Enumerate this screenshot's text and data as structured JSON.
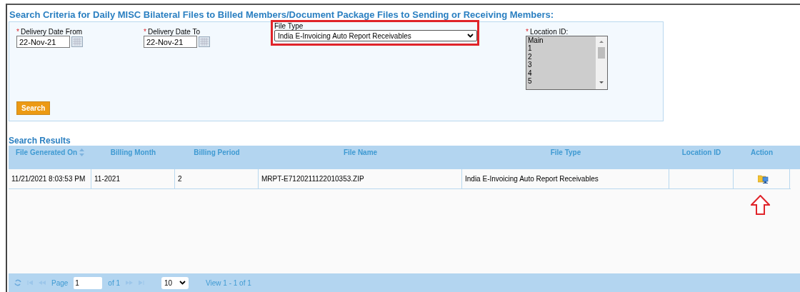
{
  "criteria": {
    "title": "Search Criteria for Daily MISC Bilateral Files to Billed Members/Document Package Files to Sending or Receiving Members:",
    "date_from": {
      "label": "Delivery Date From",
      "required_mark": "*",
      "value": "22-Nov-21"
    },
    "date_to": {
      "label": "Delivery Date To",
      "required_mark": "*",
      "value": "22-Nov-21"
    },
    "file_type": {
      "label": "File Type",
      "value": "India E-Invoicing Auto Report Receivables",
      "highlighted": true
    },
    "location": {
      "label": "Location ID:",
      "required_mark": "*",
      "options": [
        "Main",
        "1",
        "2",
        "3",
        "4",
        "5"
      ]
    },
    "search_button": "Search"
  },
  "results": {
    "title": "Search Results",
    "columns": [
      {
        "label": "File Generated On",
        "sortable": true
      },
      {
        "label": "Billing Month",
        "sortable": false
      },
      {
        "label": "Billing Period",
        "sortable": false
      },
      {
        "label": "File Name",
        "sortable": false
      },
      {
        "label": "File Type",
        "sortable": false
      },
      {
        "label": "Location ID",
        "sortable": false
      },
      {
        "label": "Action",
        "sortable": false
      }
    ],
    "rows": [
      {
        "cells": [
          "11/21/2021 8:03:53 PM",
          "11-2021",
          "2",
          "MRPT-E7120211122010353.ZIP",
          "India E-Invoicing Auto Report Receivables",
          ""
        ],
        "action_pointed": true
      }
    ],
    "pager": {
      "page_label": "Page",
      "page": "1",
      "of": "of 1",
      "page_size": "10",
      "view": "View 1 - 1 of 1"
    }
  }
}
